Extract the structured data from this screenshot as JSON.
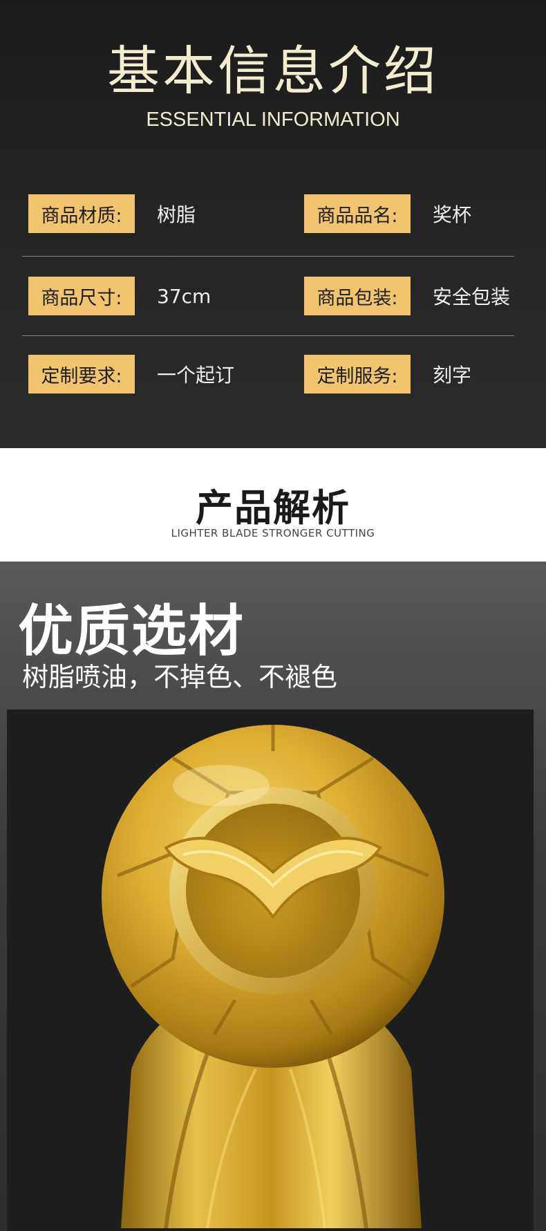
{
  "info": {
    "title": "基本信息介绍",
    "subtitle": "ESSENTIAL INFORMATION",
    "rows": [
      {
        "left_label": "商品材质:",
        "left_value": "树脂",
        "right_label": "商品品名:",
        "right_value": "奖杯"
      },
      {
        "left_label": "商品尺寸:",
        "left_value": "37cm",
        "right_label": "商品包装:",
        "right_value": "安全包装"
      },
      {
        "left_label": "定制要求:",
        "left_value": "一个起订",
        "right_label": "定制服务:",
        "right_value": "刻字"
      }
    ]
  },
  "analysis": {
    "title": "产品解析",
    "subtitle": "LIGHTER BLADE STRONGER CUTTING"
  },
  "material": {
    "title": "优质选材",
    "description": "树脂喷油，不掉色、不褪色"
  },
  "colors": {
    "tag_bg": "#f2c46d",
    "gold": "#d6a62e",
    "dark_bg": "#1b1b1b"
  },
  "images": {
    "product_photo": "golden-football-trophy-with-logo"
  }
}
